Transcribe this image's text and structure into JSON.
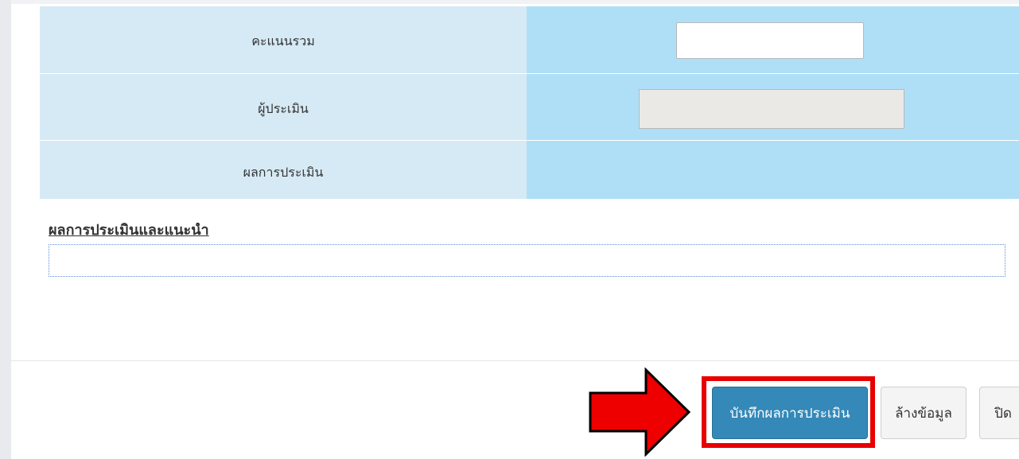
{
  "form": {
    "rows": [
      {
        "label": "คะแนนรวม",
        "value": ""
      },
      {
        "label": "ผู้ประเมิน",
        "value": ""
      },
      {
        "label": "ผลการประเมิน",
        "value": ""
      }
    ]
  },
  "comments": {
    "title": "ผลการประเมินและแนะนำ",
    "value": ""
  },
  "footer": {
    "save_label": "บันทึกผลการประเมิน",
    "clear_label": "ล้างข้อมูล",
    "close_label": "ปิด"
  },
  "annotation": {
    "highlight_color": "#e80000",
    "arrow_icon": "red-arrow-right-icon"
  }
}
